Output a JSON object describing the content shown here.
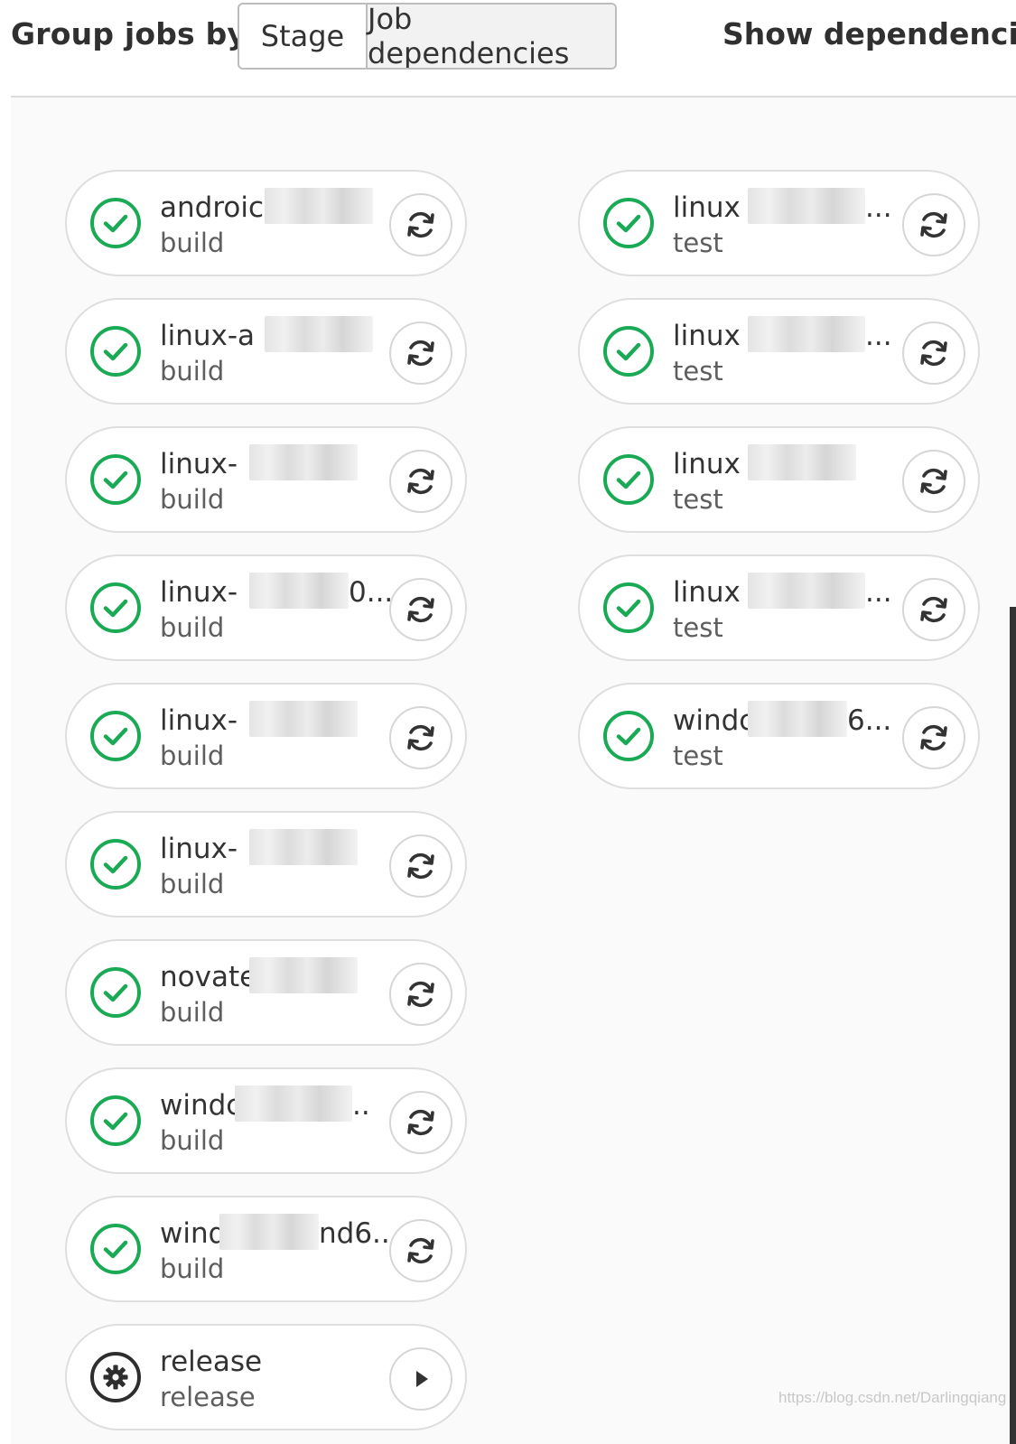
{
  "header": {
    "group_label": "Group jobs by",
    "options": [
      "Stage",
      "Job dependencies"
    ],
    "selected": "Job dependencies",
    "show_dependencies_label": "Show dependencies"
  },
  "columns": [
    {
      "jobs": [
        {
          "name": "androic",
          "stage": "build",
          "status": "success",
          "action": "retry-icon"
        },
        {
          "name": "linux-a",
          "stage": "build",
          "status": "success",
          "action": "retry-icon"
        },
        {
          "name": "linux-",
          "stage": "build",
          "status": "success",
          "action": "retry-icon"
        },
        {
          "name": "linux-",
          "suffix": "0...",
          "stage": "build",
          "status": "success",
          "action": "retry-icon"
        },
        {
          "name": "linux-",
          "stage": "build",
          "status": "success",
          "action": "retry-icon"
        },
        {
          "name": "linux-",
          "stage": "build",
          "status": "success",
          "action": "retry-icon"
        },
        {
          "name": "novate",
          "stage": "build",
          "status": "success",
          "action": "retry-icon"
        },
        {
          "name": "windc",
          "suffix": "..",
          "stage": "build",
          "status": "success",
          "action": "retry-icon"
        },
        {
          "name": "wind",
          "suffix": "nd6...",
          "stage": "build",
          "status": "success",
          "action": "retry-icon"
        },
        {
          "name": "release",
          "stage": "release",
          "status": "manual",
          "action": "play-icon"
        }
      ]
    },
    {
      "jobs": [
        {
          "name": "linux",
          "suffix": "...",
          "stage": "test",
          "status": "success",
          "action": "retry-icon"
        },
        {
          "name": "linux",
          "suffix": "...",
          "stage": "test",
          "status": "success",
          "action": "retry-icon"
        },
        {
          "name": "linux",
          "stage": "test",
          "status": "success",
          "action": "retry-icon"
        },
        {
          "name": "linux",
          "suffix": "...",
          "stage": "test",
          "status": "success",
          "action": "retry-icon"
        },
        {
          "name": "windc",
          "suffix": "6...",
          "stage": "test",
          "status": "success",
          "action": "retry-icon"
        }
      ]
    }
  ],
  "watermark": "https://blog.csdn.net/Darlingqiang",
  "colors": {
    "success": "#1aaa55",
    "manual": "#2e2e2e",
    "border": "#dedede"
  }
}
